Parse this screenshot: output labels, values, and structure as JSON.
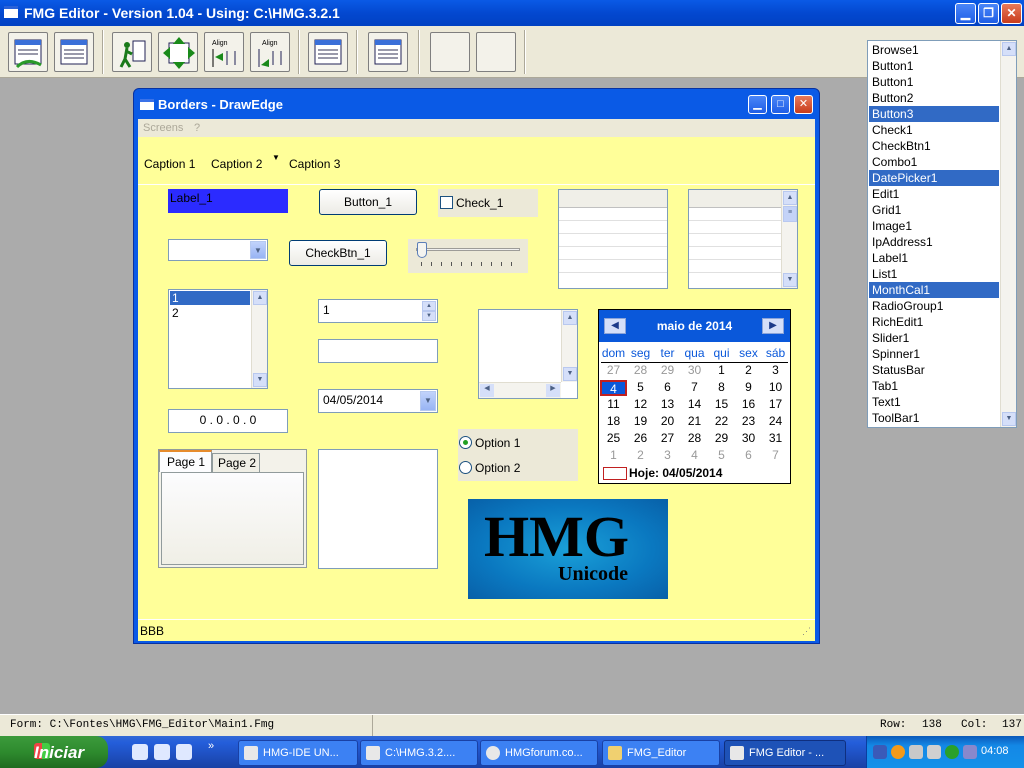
{
  "app": {
    "title": "FMG Editor - Version  1.04 - Using: C:\\HMG.3.2.1"
  },
  "form": {
    "title": "Borders - DrawEdge",
    "menu": [
      "Screens",
      "?"
    ],
    "captions": [
      "Caption 1",
      "Caption 2",
      "Caption 3"
    ],
    "label1": "Label_1",
    "button1": "Button_1",
    "check1": "Check_1",
    "checkbtn1": "CheckBtn_1",
    "list_items": [
      "1",
      "2"
    ],
    "spinner_value": "1",
    "date_value": "04/05/2014",
    "ip_value": "0 . 0 . 0 . 0",
    "tabs": [
      "Page 1",
      "Page 2"
    ],
    "options": [
      "Option 1",
      "Option 2"
    ],
    "image": {
      "title": "HMG",
      "subtitle": "Unicode"
    },
    "statusbar": "BBB",
    "calendar": {
      "month": "maio de 2014",
      "dow": [
        "dom",
        "seg",
        "ter",
        "qua",
        "qui",
        "sex",
        "sáb"
      ],
      "weeks": [
        [
          "27",
          "28",
          "29",
          "30",
          "1",
          "2",
          "3"
        ],
        [
          "4",
          "5",
          "6",
          "7",
          "8",
          "9",
          "10"
        ],
        [
          "11",
          "12",
          "13",
          "14",
          "15",
          "16",
          "17"
        ],
        [
          "18",
          "19",
          "20",
          "21",
          "22",
          "23",
          "24"
        ],
        [
          "25",
          "26",
          "27",
          "28",
          "29",
          "30",
          "31"
        ],
        [
          "1",
          "2",
          "3",
          "4",
          "5",
          "6",
          "7"
        ]
      ],
      "today": "Hoje: 04/05/2014"
    }
  },
  "controls_list": {
    "items": [
      "Browse1",
      "Button1",
      "Button1",
      "Button2",
      "Button3",
      "Check1",
      "CheckBtn1",
      "Combo1",
      "DatePicker1",
      "Edit1",
      "Grid1",
      "Image1",
      "IpAddress1",
      "Label1",
      "List1",
      "MonthCal1",
      "RadioGroup1",
      "RichEdit1",
      "Slider1",
      "Spinner1",
      "StatusBar",
      "Tab1",
      "Text1",
      "ToolBar1"
    ],
    "selected": [
      4,
      8,
      15
    ]
  },
  "statusbar": {
    "form": "Form: C:\\Fontes\\HMG\\FMG_Editor\\Main1.Fmg",
    "row_label": "Row:",
    "row": "138",
    "col_label": "Col:",
    "col": "137"
  },
  "taskbar": {
    "start": "Iniciar",
    "tasks": [
      "HMG-IDE  UN...",
      "C:\\HMG.3.2....",
      "HMGforum.co...",
      "FMG_Editor",
      "FMG Editor - ..."
    ],
    "clock": "04:08"
  },
  "colors": {
    "titlebar": "#0a5ae6",
    "form_bg": "#ffff99",
    "label_bg": "#2b2bff",
    "selection": "#316ac5"
  }
}
